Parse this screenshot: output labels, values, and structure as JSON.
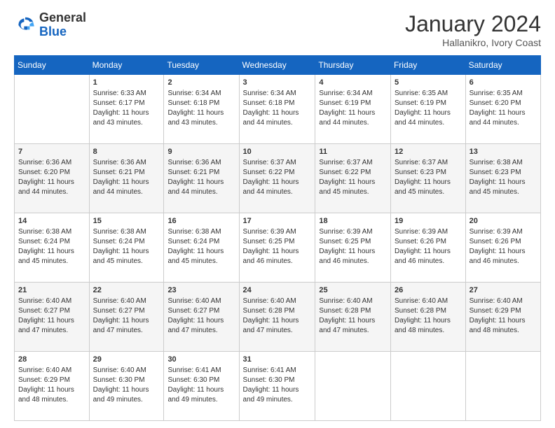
{
  "header": {
    "logo_general": "General",
    "logo_blue": "Blue",
    "main_title": "January 2024",
    "subtitle": "Hallanikro, Ivory Coast"
  },
  "days_of_week": [
    "Sunday",
    "Monday",
    "Tuesday",
    "Wednesday",
    "Thursday",
    "Friday",
    "Saturday"
  ],
  "weeks": [
    [
      {
        "num": "",
        "sunrise": "",
        "sunset": "",
        "daylight": "",
        "empty": true
      },
      {
        "num": "1",
        "sunrise": "Sunrise: 6:33 AM",
        "sunset": "Sunset: 6:17 PM",
        "daylight": "Daylight: 11 hours and 43 minutes."
      },
      {
        "num": "2",
        "sunrise": "Sunrise: 6:34 AM",
        "sunset": "Sunset: 6:18 PM",
        "daylight": "Daylight: 11 hours and 43 minutes."
      },
      {
        "num": "3",
        "sunrise": "Sunrise: 6:34 AM",
        "sunset": "Sunset: 6:18 PM",
        "daylight": "Daylight: 11 hours and 44 minutes."
      },
      {
        "num": "4",
        "sunrise": "Sunrise: 6:34 AM",
        "sunset": "Sunset: 6:19 PM",
        "daylight": "Daylight: 11 hours and 44 minutes."
      },
      {
        "num": "5",
        "sunrise": "Sunrise: 6:35 AM",
        "sunset": "Sunset: 6:19 PM",
        "daylight": "Daylight: 11 hours and 44 minutes."
      },
      {
        "num": "6",
        "sunrise": "Sunrise: 6:35 AM",
        "sunset": "Sunset: 6:20 PM",
        "daylight": "Daylight: 11 hours and 44 minutes."
      }
    ],
    [
      {
        "num": "7",
        "sunrise": "Sunrise: 6:36 AM",
        "sunset": "Sunset: 6:20 PM",
        "daylight": "Daylight: 11 hours and 44 minutes."
      },
      {
        "num": "8",
        "sunrise": "Sunrise: 6:36 AM",
        "sunset": "Sunset: 6:21 PM",
        "daylight": "Daylight: 11 hours and 44 minutes."
      },
      {
        "num": "9",
        "sunrise": "Sunrise: 6:36 AM",
        "sunset": "Sunset: 6:21 PM",
        "daylight": "Daylight: 11 hours and 44 minutes."
      },
      {
        "num": "10",
        "sunrise": "Sunrise: 6:37 AM",
        "sunset": "Sunset: 6:22 PM",
        "daylight": "Daylight: 11 hours and 44 minutes."
      },
      {
        "num": "11",
        "sunrise": "Sunrise: 6:37 AM",
        "sunset": "Sunset: 6:22 PM",
        "daylight": "Daylight: 11 hours and 45 minutes."
      },
      {
        "num": "12",
        "sunrise": "Sunrise: 6:37 AM",
        "sunset": "Sunset: 6:23 PM",
        "daylight": "Daylight: 11 hours and 45 minutes."
      },
      {
        "num": "13",
        "sunrise": "Sunrise: 6:38 AM",
        "sunset": "Sunset: 6:23 PM",
        "daylight": "Daylight: 11 hours and 45 minutes."
      }
    ],
    [
      {
        "num": "14",
        "sunrise": "Sunrise: 6:38 AM",
        "sunset": "Sunset: 6:24 PM",
        "daylight": "Daylight: 11 hours and 45 minutes."
      },
      {
        "num": "15",
        "sunrise": "Sunrise: 6:38 AM",
        "sunset": "Sunset: 6:24 PM",
        "daylight": "Daylight: 11 hours and 45 minutes."
      },
      {
        "num": "16",
        "sunrise": "Sunrise: 6:38 AM",
        "sunset": "Sunset: 6:24 PM",
        "daylight": "Daylight: 11 hours and 45 minutes."
      },
      {
        "num": "17",
        "sunrise": "Sunrise: 6:39 AM",
        "sunset": "Sunset: 6:25 PM",
        "daylight": "Daylight: 11 hours and 46 minutes."
      },
      {
        "num": "18",
        "sunrise": "Sunrise: 6:39 AM",
        "sunset": "Sunset: 6:25 PM",
        "daylight": "Daylight: 11 hours and 46 minutes."
      },
      {
        "num": "19",
        "sunrise": "Sunrise: 6:39 AM",
        "sunset": "Sunset: 6:26 PM",
        "daylight": "Daylight: 11 hours and 46 minutes."
      },
      {
        "num": "20",
        "sunrise": "Sunrise: 6:39 AM",
        "sunset": "Sunset: 6:26 PM",
        "daylight": "Daylight: 11 hours and 46 minutes."
      }
    ],
    [
      {
        "num": "21",
        "sunrise": "Sunrise: 6:40 AM",
        "sunset": "Sunset: 6:27 PM",
        "daylight": "Daylight: 11 hours and 47 minutes."
      },
      {
        "num": "22",
        "sunrise": "Sunrise: 6:40 AM",
        "sunset": "Sunset: 6:27 PM",
        "daylight": "Daylight: 11 hours and 47 minutes."
      },
      {
        "num": "23",
        "sunrise": "Sunrise: 6:40 AM",
        "sunset": "Sunset: 6:27 PM",
        "daylight": "Daylight: 11 hours and 47 minutes."
      },
      {
        "num": "24",
        "sunrise": "Sunrise: 6:40 AM",
        "sunset": "Sunset: 6:28 PM",
        "daylight": "Daylight: 11 hours and 47 minutes."
      },
      {
        "num": "25",
        "sunrise": "Sunrise: 6:40 AM",
        "sunset": "Sunset: 6:28 PM",
        "daylight": "Daylight: 11 hours and 47 minutes."
      },
      {
        "num": "26",
        "sunrise": "Sunrise: 6:40 AM",
        "sunset": "Sunset: 6:28 PM",
        "daylight": "Daylight: 11 hours and 48 minutes."
      },
      {
        "num": "27",
        "sunrise": "Sunrise: 6:40 AM",
        "sunset": "Sunset: 6:29 PM",
        "daylight": "Daylight: 11 hours and 48 minutes."
      }
    ],
    [
      {
        "num": "28",
        "sunrise": "Sunrise: 6:40 AM",
        "sunset": "Sunset: 6:29 PM",
        "daylight": "Daylight: 11 hours and 48 minutes."
      },
      {
        "num": "29",
        "sunrise": "Sunrise: 6:40 AM",
        "sunset": "Sunset: 6:30 PM",
        "daylight": "Daylight: 11 hours and 49 minutes."
      },
      {
        "num": "30",
        "sunrise": "Sunrise: 6:41 AM",
        "sunset": "Sunset: 6:30 PM",
        "daylight": "Daylight: 11 hours and 49 minutes."
      },
      {
        "num": "31",
        "sunrise": "Sunrise: 6:41 AM",
        "sunset": "Sunset: 6:30 PM",
        "daylight": "Daylight: 11 hours and 49 minutes."
      },
      {
        "num": "",
        "sunrise": "",
        "sunset": "",
        "daylight": "",
        "empty": true
      },
      {
        "num": "",
        "sunrise": "",
        "sunset": "",
        "daylight": "",
        "empty": true
      },
      {
        "num": "",
        "sunrise": "",
        "sunset": "",
        "daylight": "",
        "empty": true
      }
    ]
  ]
}
